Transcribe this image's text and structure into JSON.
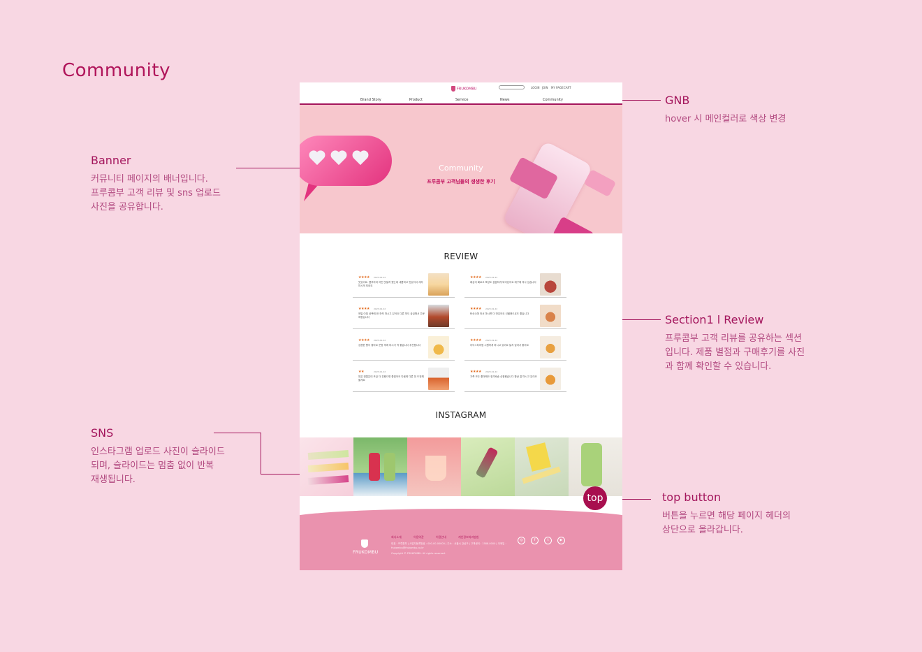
{
  "page": {
    "title": "Community"
  },
  "annotations": {
    "gnb": {
      "title": "GNB",
      "desc": "hover 시 메인컬러로 색상 변경"
    },
    "banner": {
      "title": "Banner",
      "desc": "커뮤니티 페이지의 배너입니다.\n프루콤부 고객 리뷰 및 sns 업로드\n사진을 공유합니다."
    },
    "review": {
      "title": "Section1 l Review",
      "desc": "프루콤부 고객 리뷰를 공유하는 섹션\n입니다. 제품 별점과 구매후기를 사진\n과 함께 확인할 수 있습니다."
    },
    "sns": {
      "title": "SNS",
      "desc": "인스타그램 업로드 사진이 슬라이드\n되며, 슬라이드는 멈춤 없이 반복\n재생됩니다."
    },
    "top": {
      "title": "top button",
      "desc": "버튼을 누르면 해당 페이지 헤더의\n상단으로 올라갑니다."
    }
  },
  "mockup": {
    "gnb": {
      "logo": "FRUKOMBU",
      "util": [
        "LOGIN",
        "JOIN",
        "MY PAGE",
        "CART"
      ],
      "nav": [
        "Brand Story",
        "Product",
        "Service",
        "News",
        "Community"
      ]
    },
    "banner": {
      "title": "Community",
      "subtitle": "프루콤부 고객님들의 생생한 후기"
    },
    "review_title": "REVIEW",
    "reviews": [
      {
        "stars": "★★★★",
        "meta": "2023.01.22",
        "text": "맛있어요. 콤부차라 어떤 맛일까 했는데 새콤하고 맛있어서 계속 마시게 되네요"
      },
      {
        "stars": "★★★★",
        "meta": "2023.01.22",
        "text": "배송이 빠르고 포장도 꼼꼼하게 되어있어요 재구매 의사 있습니다"
      },
      {
        "stars": "★★★★",
        "meta": "2023.01.22",
        "text": "매일 아침 공복에 한 잔씩 마시고 있어요 다른 맛도 궁금해서 주문 예정입니다"
      },
      {
        "stars": "★★★★",
        "meta": "2023.01.22",
        "text": "탄산수에 타서 마시면 더 맛있어요 선물용으로도 좋습니다"
      },
      {
        "stars": "★★★★",
        "meta": "2023.01.22",
        "text": "상큼한 향이 좋아요 운동 후에 마시기 딱 좋습니다 추천합니다"
      },
      {
        "stars": "★★★★",
        "meta": "2023.01.22",
        "text": "아이스티처럼 시원하게 마시고 있어요 달지 않아서 좋아요"
      },
      {
        "stars": "★★",
        "meta": "2023.01.22",
        "text": "맛은 괜찮은데 조금 더 진했으면 좋겠어요 다음에 다른 맛 도전해볼게요"
      },
      {
        "stars": "★★★★",
        "meta": "2023.01.22",
        "text": "가족 모두 좋아해요 정기배송 신청했습니다 항상 잘 마시고 있어요"
      }
    ],
    "instagram_title": "INSTAGRAM",
    "top_button": "top",
    "footer": {
      "logo": "FRUKOMBU",
      "links": [
        "회사소개",
        "이용약관",
        "이용안내",
        "개인정보처리방침"
      ],
      "info": "대표 : 프루콤부 | 사업자등록번호 : 000-00-00000 | 주소 : 서울시 강남구 | 고객센터 : 1588-0000 | 이메일 : frukombu@frukombu.co.kr",
      "copyright": "Copyright © FRUKOMBU. All rights reserved.",
      "social": [
        "instagram-icon",
        "facebook-icon",
        "twitter-icon",
        "youtube-icon"
      ]
    }
  }
}
